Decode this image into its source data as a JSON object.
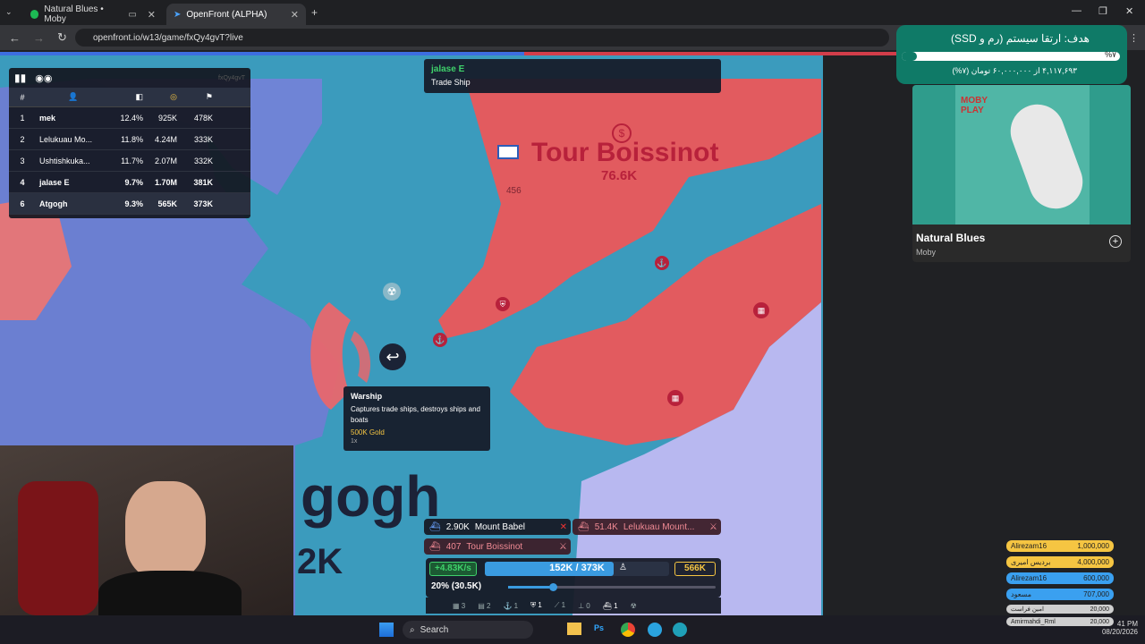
{
  "browser": {
    "tabs": [
      {
        "label": "Natural Blues • Moby",
        "icon": "spotify-icon"
      },
      {
        "label": "OpenFront (ALPHA)",
        "icon": "openfront-icon"
      }
    ],
    "url": "openfront.io/w13/game/fxQy4gvT?live"
  },
  "leaderboard": {
    "id": "fxQy4gvT",
    "headers": [
      "#",
      "",
      "",
      "",
      "",
      "",
      ""
    ],
    "rows": [
      {
        "rank": "1",
        "name": "mek",
        "pct": "12.4%",
        "gold": "925K",
        "troops": "478K"
      },
      {
        "rank": "2",
        "name": "Lelukuau Mo...",
        "pct": "11.8%",
        "gold": "4.24M",
        "troops": "333K"
      },
      {
        "rank": "3",
        "name": "Ushtishkuka...",
        "pct": "11.7%",
        "gold": "2.07M",
        "troops": "332K"
      },
      {
        "rank": "4",
        "name": "jalase E",
        "pct": "9.7%",
        "gold": "1.70M",
        "troops": "381K"
      },
      {
        "rank": "6",
        "name": "Atgogh",
        "pct": "9.3%",
        "gold": "565K",
        "troops": "373K"
      }
    ]
  },
  "trade_tooltip": {
    "player": "jalase E",
    "unit": "Trade Ship"
  },
  "map": {
    "tour_name": "Tour Boissinot",
    "tour_troops": "76.6K",
    "small_num": "456",
    "atgogh_text": "gogh",
    "atgogh_num": "2K"
  },
  "warship_tooltip": {
    "title": "Warship",
    "desc": "Captures trade ships, destroys ships and boats",
    "cost": "500K Gold",
    "count": "1x"
  },
  "attacks": {
    "a1_amount": "2.90K",
    "a1_target": "Mount Babel",
    "a2_amount": "51.4K",
    "a2_target": "Lelukuau Mount...",
    "a3_amount": "407",
    "a3_target": "Tour Boissinot"
  },
  "hud": {
    "rate": "+4.83K/s",
    "troops": "152K / 373K",
    "gold": "566K",
    "ratio": "20% (30.5K)",
    "slider_pct": 0.2,
    "counts": [
      "3",
      "2",
      "1",
      "1",
      "1",
      "0",
      "1"
    ]
  },
  "goal": {
    "title": "هدف: ارتقا سیستم (رم و SSD)",
    "amount": "۴,۱۱۷,۶۹۳ از ۶۰,۰۰۰,۰۰۰ تومان (۷%)",
    "pct": "%۷"
  },
  "spotify": {
    "track": "Natural Blues",
    "artist": "Moby",
    "album_text": "MOBY PLAY"
  },
  "donors": [
    {
      "name": "Alirezam16",
      "amount": "1,000,000",
      "color": "#f5c542"
    },
    {
      "name": "بردیس امیری",
      "amount": "4,000,000",
      "color": "#f5c542"
    },
    {
      "name": "Alirezam16",
      "amount": "600,000",
      "color": "#3aa0f0"
    },
    {
      "name": "مسعود",
      "amount": "707,000",
      "color": "#3aa0f0"
    },
    {
      "name": "امین فراست",
      "amount": "20,000",
      "color": "#cfcfcf"
    },
    {
      "name": "Amirmahdi_Rml",
      "amount": "20,000",
      "color": "#cfcfcf"
    }
  ],
  "taskbar": {
    "search": "Search",
    "time": "41 PM",
    "date": "08/20/2026"
  },
  "colors": {
    "ocean": "#3b9bbd",
    "red_team": "#e25b5f",
    "blue_team": "#6b7fd1"
  }
}
